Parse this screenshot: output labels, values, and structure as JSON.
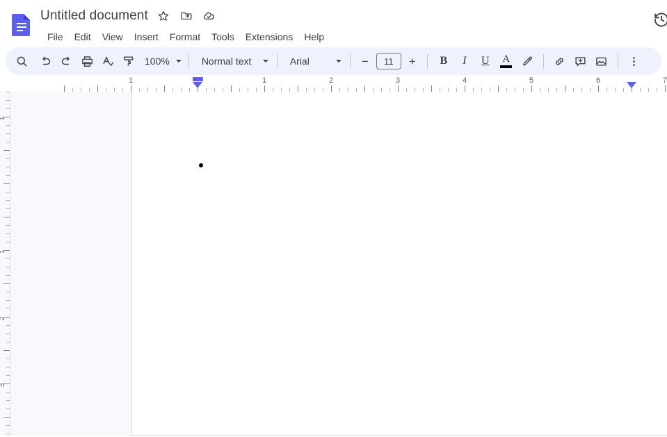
{
  "app": {
    "logo_name": "google-docs-logo",
    "brand_color": "#4e53ea"
  },
  "header": {
    "document_title": "Untitled document",
    "title_icons": [
      {
        "name": "star-icon",
        "label": "Star"
      },
      {
        "name": "move-to-folder-icon",
        "label": "Move"
      },
      {
        "name": "cloud-saved-icon",
        "label": "Saved to Drive"
      }
    ],
    "menu_items": [
      "File",
      "Edit",
      "View",
      "Insert",
      "Format",
      "Tools",
      "Extensions",
      "Help"
    ],
    "history_icon_label": "Version history"
  },
  "toolbar": {
    "buttons": [
      {
        "name": "search-icon",
        "label": "Search"
      },
      {
        "name": "undo-icon",
        "label": "Undo"
      },
      {
        "name": "redo-icon",
        "label": "Redo"
      },
      {
        "name": "print-icon",
        "label": "Print"
      },
      {
        "name": "spelling-check-icon",
        "label": "Spelling and grammar check"
      },
      {
        "name": "paint-format-icon",
        "label": "Paint format"
      }
    ],
    "zoom_level": "100%",
    "paragraph_style": "Normal text",
    "font_family": "Arial",
    "font_size": "11",
    "decrease_font_label": "−",
    "increase_font_label": "+",
    "format_buttons": [
      {
        "name": "bold-button",
        "label": "B"
      },
      {
        "name": "italic-button",
        "label": "I"
      },
      {
        "name": "underline-button",
        "label": "U"
      }
    ],
    "text_color": {
      "name": "text-color-button",
      "label": "A",
      "color": "#000000"
    },
    "highlight_label": "Highlight color",
    "insert_buttons": [
      {
        "name": "insert-link-icon",
        "label": "Insert link"
      },
      {
        "name": "add-comment-icon",
        "label": "Add comment"
      },
      {
        "name": "insert-image-icon",
        "label": "Insert image"
      }
    ],
    "more_options_label": "More"
  },
  "ruler": {
    "horizontal_numbers": [
      "1",
      "1",
      "2",
      "3",
      "4",
      "5",
      "6",
      "7"
    ],
    "vertical_numbers": [
      "1",
      "1",
      "2",
      "3"
    ],
    "left_indent_marker": "left-indent-marker",
    "right_indent_marker": "right-indent-marker",
    "marker_color": "#5d5fef"
  },
  "document": {
    "bullet_char": "•",
    "body_text": ""
  }
}
